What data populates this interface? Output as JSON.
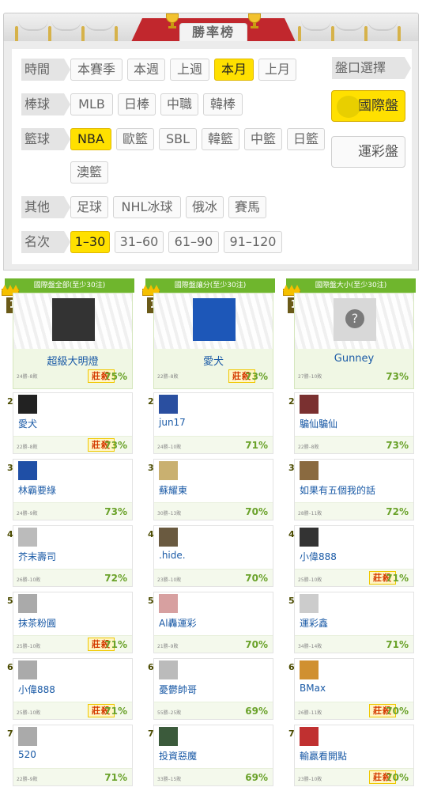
{
  "header": {
    "title": "勝率榜"
  },
  "filters": {
    "rows": [
      {
        "label": "時間",
        "options": [
          "本賽季",
          "本週",
          "上週",
          "本月",
          "上月"
        ],
        "selected": 3
      },
      {
        "label": "棒球",
        "options": [
          "MLB",
          "日棒",
          "中職",
          "韓棒"
        ],
        "selected": -1
      },
      {
        "label": "籃球",
        "options": [
          "NBA",
          "歐籃",
          "SBL",
          "韓籃",
          "中籃",
          "日籃",
          "澳籃"
        ],
        "selected": 0
      },
      {
        "label": "其他",
        "options": [
          "足球",
          "NHL冰球",
          "俄冰",
          "賽馬"
        ],
        "selected": -1
      },
      {
        "label": "名次",
        "options": [
          "1–30",
          "31–60",
          "61–90",
          "91–120"
        ],
        "selected": 0
      }
    ],
    "market": {
      "label": "盤口選擇",
      "options": [
        "國際盤",
        "運彩盤"
      ],
      "selected": 0
    }
  },
  "badge": "莊殺",
  "columns": [
    {
      "title": "國際盤全部(至少30注)",
      "top": {
        "rank": "1",
        "name": "超級大明燈",
        "record": "24勝–8敗",
        "pct": "75%",
        "kill": true
      },
      "entries": [
        {
          "rank": "2",
          "name": "愛犬",
          "record": "22勝–8敗",
          "pct": "73%",
          "kill": true
        },
        {
          "rank": "3",
          "name": "林霸要綠",
          "record": "24勝–9敗",
          "pct": "73%",
          "kill": false
        },
        {
          "rank": "4",
          "name": "芥末壽司",
          "record": "26勝–10敗",
          "pct": "72%",
          "kill": false
        },
        {
          "rank": "5",
          "name": "抹茶粉圓",
          "record": "25勝–10敗",
          "pct": "71%",
          "kill": true
        },
        {
          "rank": "6",
          "name": "小偉888",
          "record": "25勝–10敗",
          "pct": "71%",
          "kill": true
        },
        {
          "rank": "7",
          "name": "520",
          "record": "22勝–9敗",
          "pct": "71%",
          "kill": false
        }
      ]
    },
    {
      "title": "國際盤讓分(至少30注)",
      "top": {
        "rank": "1",
        "name": "愛犬",
        "record": "22勝–8敗",
        "pct": "73%",
        "kill": true
      },
      "entries": [
        {
          "rank": "2",
          "name": "jun17",
          "record": "24勝–10敗",
          "pct": "71%",
          "kill": false
        },
        {
          "rank": "3",
          "name": "蘇耀東",
          "record": "30勝–13敗",
          "pct": "70%",
          "kill": false
        },
        {
          "rank": "4",
          "name": ".hide.",
          "record": "23勝–10敗",
          "pct": "70%",
          "kill": false
        },
        {
          "rank": "5",
          "name": "Al轟運彩",
          "record": "21勝–9敗",
          "pct": "70%",
          "kill": false
        },
        {
          "rank": "6",
          "name": "憂鬱帥哥",
          "record": "55勝–25敗",
          "pct": "69%",
          "kill": false
        },
        {
          "rank": "7",
          "name": "投資惡魔",
          "record": "33勝–15敗",
          "pct": "69%",
          "kill": false
        }
      ]
    },
    {
      "title": "國際盤大小(至少30注)",
      "top": {
        "rank": "1",
        "name": "Gunney",
        "record": "27勝–10敗",
        "pct": "73%",
        "kill": false
      },
      "entries": [
        {
          "rank": "2",
          "name": "騙仙騙仙",
          "record": "22勝–8敗",
          "pct": "73%",
          "kill": false
        },
        {
          "rank": "3",
          "name": "如果有五個我的話",
          "record": "28勝–11敗",
          "pct": "72%",
          "kill": false
        },
        {
          "rank": "4",
          "name": "小偉888",
          "record": "25勝–10敗",
          "pct": "71%",
          "kill": true
        },
        {
          "rank": "5",
          "name": "運彩鑫",
          "record": "34勝–14敗",
          "pct": "71%",
          "kill": false
        },
        {
          "rank": "6",
          "name": "BMax",
          "record": "26勝–11敗",
          "pct": "70%",
          "kill": true
        },
        {
          "rank": "7",
          "name": "輸贏看開點",
          "record": "23勝–10敗",
          "pct": "70%",
          "kill": true
        }
      ]
    }
  ],
  "icons": {
    "crown": "crown-icon",
    "trophy": "trophy-icon",
    "globe": "globe-icon",
    "placeholder": "mystery-avatar-icon"
  },
  "colors": {
    "accent_yellow": "#ffe000",
    "green_header": "#6fb62d",
    "kill_red": "#d43a00",
    "name_blue": "#1a5aa6",
    "pct_green": "#6aa22a"
  }
}
